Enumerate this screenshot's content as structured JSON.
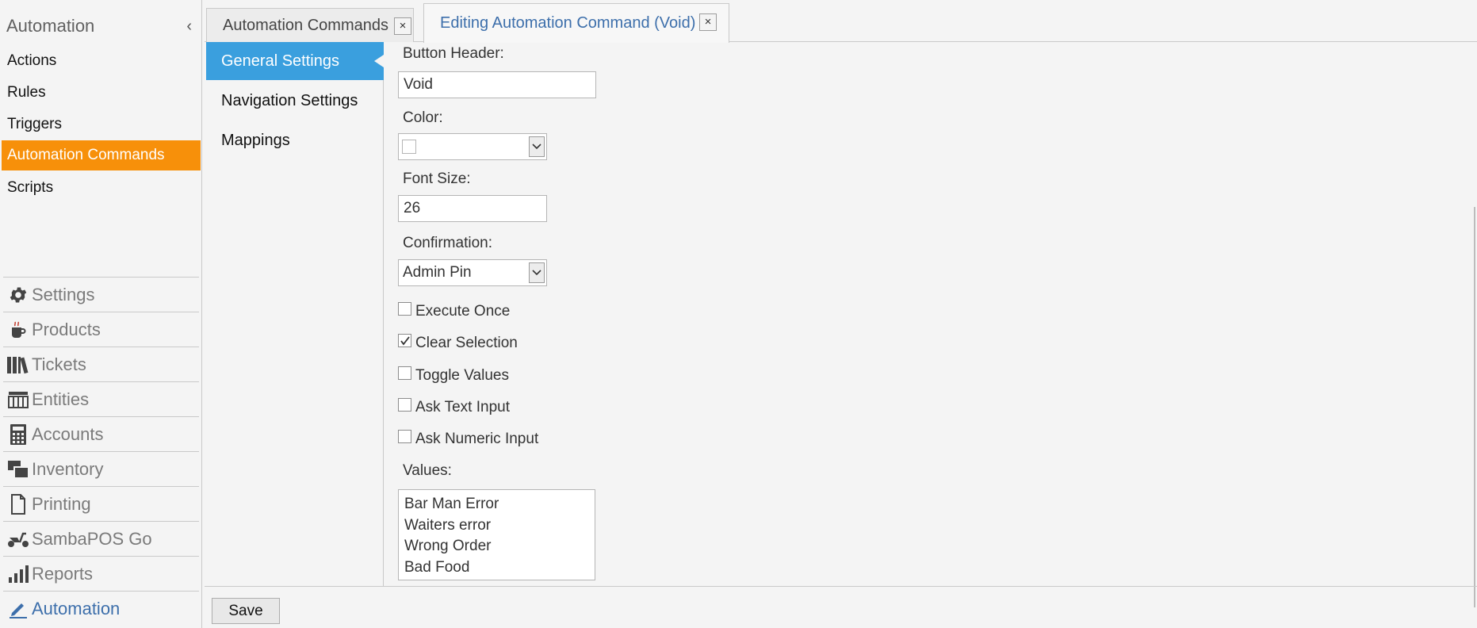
{
  "sidebar": {
    "title": "Automation",
    "collapse_glyph": "‹",
    "sub_items": [
      {
        "label": "Actions",
        "active": false
      },
      {
        "label": "Rules",
        "active": false
      },
      {
        "label": "Triggers",
        "active": false
      },
      {
        "label": "Automation Commands",
        "active": true
      },
      {
        "label": "Scripts",
        "active": false
      }
    ],
    "modules": [
      {
        "label": "Settings",
        "icon": "gear-icon"
      },
      {
        "label": "Products",
        "icon": "coffee-cup-icon"
      },
      {
        "label": "Tickets",
        "icon": "books-icon"
      },
      {
        "label": "Entities",
        "icon": "table-grid-icon"
      },
      {
        "label": "Accounts",
        "icon": "calculator-icon"
      },
      {
        "label": "Inventory",
        "icon": "stacked-boxes-icon"
      },
      {
        "label": "Printing",
        "icon": "document-icon"
      },
      {
        "label": "SambaPOS Go",
        "icon": "scooter-icon"
      },
      {
        "label": "Reports",
        "icon": "bar-chart-icon"
      },
      {
        "label": "Automation",
        "icon": "pencil-icon",
        "active": true
      }
    ]
  },
  "tabs": [
    {
      "label": "Automation Commands",
      "active": false
    },
    {
      "label": "Editing Automation Command (Void)",
      "active": true
    }
  ],
  "tab_close_glyph": "×",
  "settings_nav": [
    {
      "label": "General Settings",
      "active": true
    },
    {
      "label": "Navigation Settings",
      "active": false
    },
    {
      "label": "Mappings",
      "active": false
    }
  ],
  "form": {
    "button_header_label": "Button Header:",
    "button_header_value": "Void",
    "color_label": "Color:",
    "color_value": "",
    "font_size_label": "Font Size:",
    "font_size_value": "26",
    "confirmation_label": "Confirmation:",
    "confirmation_value": "Admin Pin",
    "checkboxes": [
      {
        "label": "Execute Once",
        "checked": false
      },
      {
        "label": "Clear Selection",
        "checked": true
      },
      {
        "label": "Toggle Values",
        "checked": false
      },
      {
        "label": "Ask Text Input",
        "checked": false
      },
      {
        "label": "Ask Numeric Input",
        "checked": false
      }
    ],
    "values_label": "Values:",
    "values": [
      "Bar Man Error",
      "Waiters error",
      "Wrong Order",
      "Bad Food"
    ]
  },
  "footer": {
    "save_label": "Save"
  },
  "colors": {
    "accent_orange": "#f7900a",
    "accent_blue": "#3a9fde",
    "active_text_blue": "#3d6fab"
  }
}
